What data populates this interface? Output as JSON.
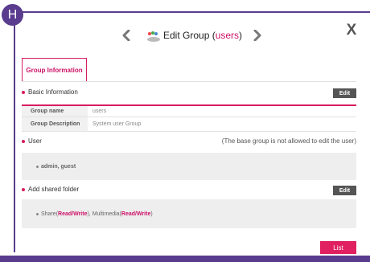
{
  "badge": {
    "label": "H"
  },
  "header": {
    "title_prefix": "Edit Group (",
    "group_name": "users",
    "title_suffix": ")",
    "prev_icon": "chevron-left-icon",
    "next_icon": "chevron-right-icon",
    "group_icon": "users-group-icon",
    "close_label": "X"
  },
  "tabs": [
    {
      "label": "Group Information",
      "active": true
    }
  ],
  "basic_info": {
    "heading": "Basic Information",
    "edit_label": "Edit",
    "rows": [
      {
        "label": "Group name",
        "value": "users"
      },
      {
        "label": "Group Description",
        "value": "System user Group"
      }
    ]
  },
  "user_section": {
    "heading": "User",
    "note": "(The base group is not allowed to edit the user)",
    "members": "admin, guest"
  },
  "shared_folder": {
    "heading": "Add shared folder",
    "edit_label": "Edit",
    "folders": [
      {
        "name": "Share",
        "permission": "Read/Write"
      },
      {
        "name": "Multimedia",
        "permission": "Read/Write"
      }
    ]
  },
  "footer": {
    "list_label": "List"
  },
  "colors": {
    "accent": "#d81b60",
    "frame": "#5a3c8e",
    "button_dark": "#555555"
  }
}
